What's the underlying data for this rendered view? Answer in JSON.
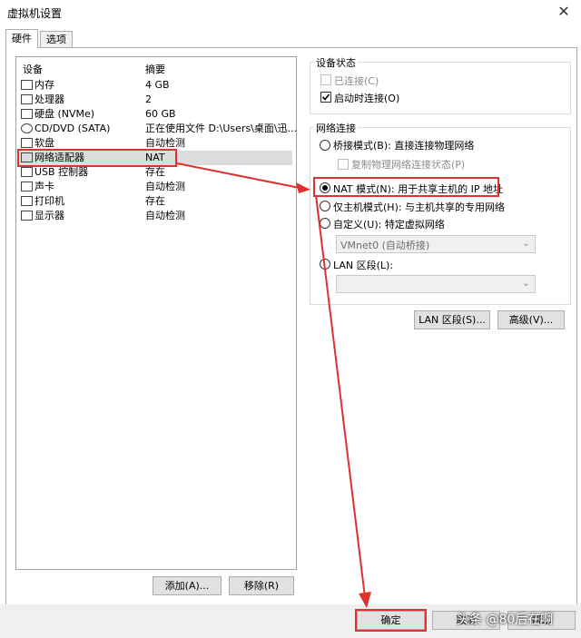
{
  "window": {
    "title": "虚拟机设置",
    "close_glyph": "✕"
  },
  "tabs": [
    {
      "label": "硬件"
    },
    {
      "label": "选项"
    }
  ],
  "device_list": {
    "header_device": "设备",
    "header_summary": "摘要",
    "rows": [
      {
        "name": "内存",
        "summary": "4 GB"
      },
      {
        "name": "处理器",
        "summary": "2"
      },
      {
        "name": "硬盘 (NVMe)",
        "summary": "60 GB"
      },
      {
        "name": "CD/DVD (SATA)",
        "summary": "正在使用文件 D:\\Users\\桌面\\迅..."
      },
      {
        "name": "软盘",
        "summary": "自动检测"
      },
      {
        "name": "网络适配器",
        "summary": "NAT"
      },
      {
        "name": "USB 控制器",
        "summary": "存在"
      },
      {
        "name": "声卡",
        "summary": "自动检测"
      },
      {
        "name": "打印机",
        "summary": "存在"
      },
      {
        "name": "显示器",
        "summary": "自动检测"
      }
    ]
  },
  "buttons": {
    "add": "添加(A)...",
    "remove": "移除(R)",
    "lan_segment": "LAN 区段(S)...",
    "advanced": "高级(V)...",
    "ok": "确定",
    "cancel": "取消",
    "help": "帮助"
  },
  "device_status": {
    "title": "设备状态",
    "connected": "已连接(C)",
    "connect_on_power": "启动时连接(O)"
  },
  "network": {
    "title": "网络连接",
    "bridged": "桥接模式(B): 直接连接物理网络",
    "replicate": "复制物理网络连接状态(P)",
    "nat": "NAT 模式(N): 用于共享主机的 IP 地址",
    "host_only": "仅主机模式(H): 与主机共享的专用网络",
    "custom": "自定义(U): 特定虚拟网络",
    "custom_value": "VMnet0 (自动桥接)",
    "lan": "LAN 区段(L):",
    "lan_value": ""
  },
  "watermark": "头条 @80后在啊",
  "colors": {
    "highlight": "#e03030"
  }
}
